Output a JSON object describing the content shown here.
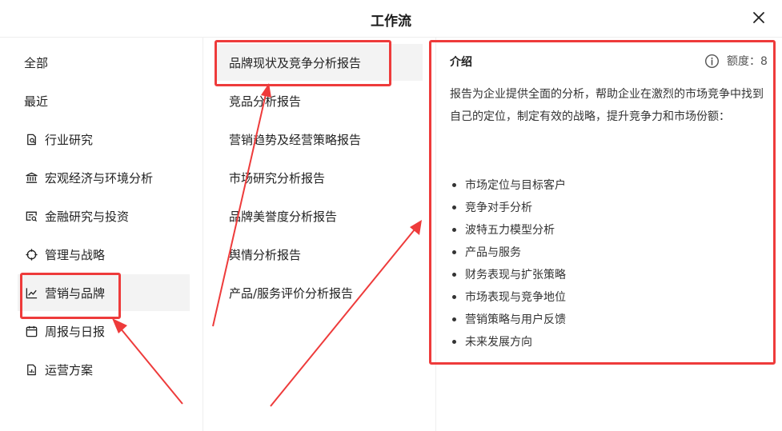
{
  "header": {
    "title": "工作流"
  },
  "categories": [
    {
      "label": "全部",
      "icon": ""
    },
    {
      "label": "最近",
      "icon": ""
    },
    {
      "label": "行业研究",
      "icon": "doc-search-icon"
    },
    {
      "label": "宏观经济与环境分析",
      "icon": "bank-icon"
    },
    {
      "label": "金融研究与投资",
      "icon": "finance-icon"
    },
    {
      "label": "管理与战略",
      "icon": "crosshair-icon"
    },
    {
      "label": "营销与品牌",
      "icon": "trend-chart-icon"
    },
    {
      "label": "周报与日报",
      "icon": "calendar-icon"
    },
    {
      "label": "运营方案",
      "icon": "report-chart-icon"
    }
  ],
  "reports": [
    "品牌现状及竞争分析报告",
    "竞品分析报告",
    "营销趋势及经营策略报告",
    "市场研究分析报告",
    "品牌美誉度分析报告",
    "舆情分析报告",
    "产品/服务评价分析报告"
  ],
  "detail": {
    "title": "介绍",
    "quota": "额度：8",
    "description": "报告为企业提供全面的分析，帮助企业在激烈的市场竞争中找到自己的定位，制定有效的战略，提升竞争力和市场份额：",
    "bullets": [
      "市场定位与目标客户",
      "竞争对手分析",
      "波特五力模型分析",
      "产品与服务",
      "财务表现与扩张策略",
      "市场表现与竞争地位",
      "营销策略与用户反馈",
      "未来发展方向"
    ]
  },
  "colors": {
    "highlight": "#ee3b3b",
    "active_bg": "#f3f3f3"
  }
}
